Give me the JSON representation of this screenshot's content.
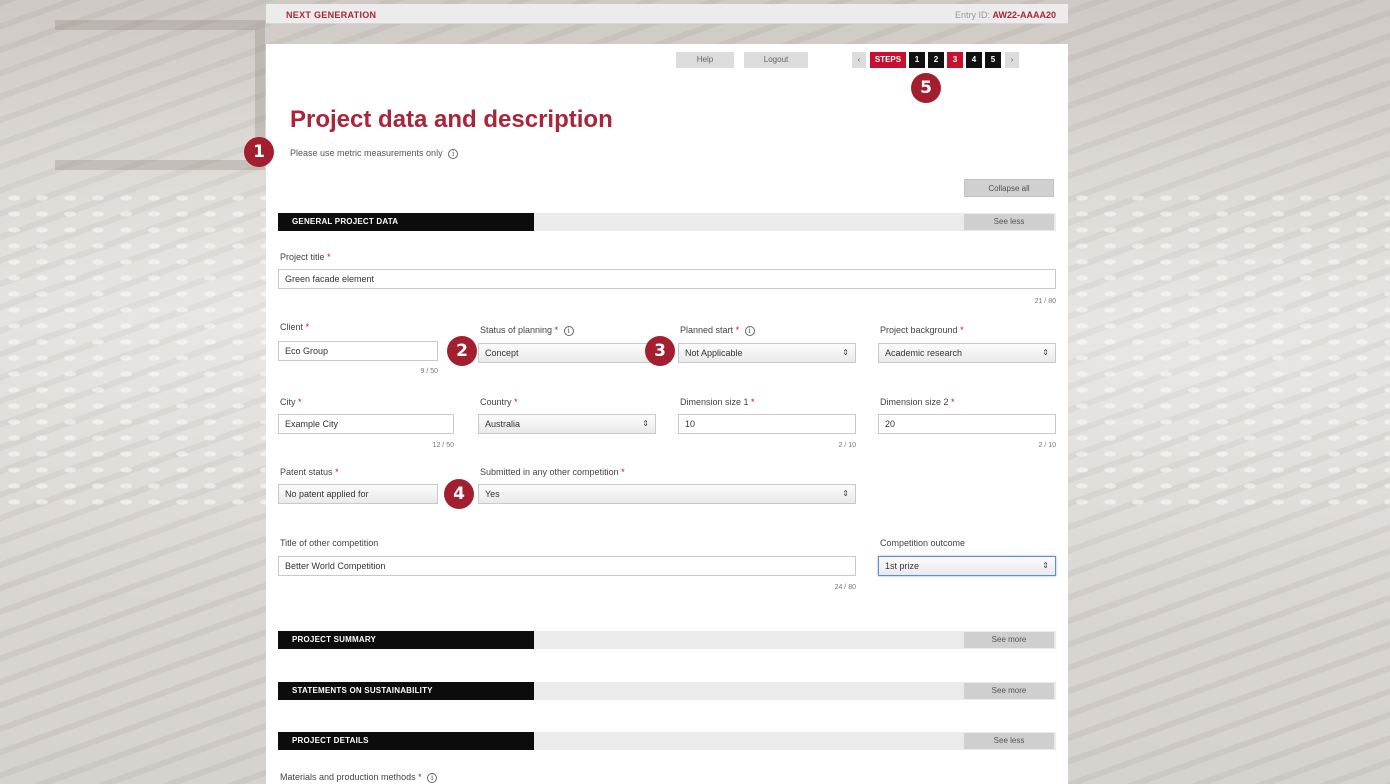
{
  "topbar": {
    "brand": "NEXT GENERATION",
    "entry_prefix": "Entry ID:",
    "entry_id": "AW22-AAAA20"
  },
  "nav": {
    "help": "Help",
    "logout": "Logout",
    "prev": "‹",
    "next": "›",
    "steps_label": "STEPS",
    "steps": [
      "1",
      "2",
      "3",
      "4",
      "5"
    ],
    "active_step": "3"
  },
  "page": {
    "title": "Project data and description",
    "subtitle": "Please use metric measurements only"
  },
  "collapse_all": "Collapse all",
  "sections": {
    "general": {
      "title": "GENERAL PROJECT DATA",
      "toggle": "See less"
    },
    "summary": {
      "title": "PROJECT SUMMARY",
      "toggle": "See more"
    },
    "sustainability": {
      "title": "STATEMENTS ON SUSTAINABILITY",
      "toggle": "See more"
    },
    "details": {
      "title": "PROJECT DETAILS",
      "toggle": "See less"
    }
  },
  "form": {
    "project_title": {
      "label": "Project title",
      "value": "Green facade element",
      "counter": "21 / 80"
    },
    "client": {
      "label": "Client",
      "value": "Eco Group",
      "counter": "9 / 50"
    },
    "status_planning": {
      "label": "Status of planning",
      "value": "Concept"
    },
    "planned_start": {
      "label": "Planned start",
      "value": "Not Applicable"
    },
    "project_background": {
      "label": "Project background",
      "value": "Academic research"
    },
    "city": {
      "label": "City",
      "value": "Example City",
      "counter": "12 / 50"
    },
    "country": {
      "label": "Country",
      "value": "Australia"
    },
    "dimension1": {
      "label": "Dimension size 1",
      "value": "10",
      "counter": "2 / 10"
    },
    "dimension2": {
      "label": "Dimension size 2",
      "value": "20",
      "counter": "2 / 10"
    },
    "patent_status": {
      "label": "Patent status",
      "value": "No patent applied for"
    },
    "other_competition": {
      "label": "Submitted in any other competition",
      "value": "Yes"
    },
    "other_competition_title": {
      "label": "Title of other competition",
      "value": "Better World Competition",
      "counter": "24 / 80"
    },
    "competition_outcome": {
      "label": "Competition outcome",
      "value": "1st prize"
    },
    "materials": {
      "label": "Materials and production methods"
    }
  },
  "required_mark": "*",
  "info_symbol": "i",
  "select_arrows": "⇕",
  "callouts": [
    "1",
    "2",
    "3",
    "4",
    "5"
  ]
}
